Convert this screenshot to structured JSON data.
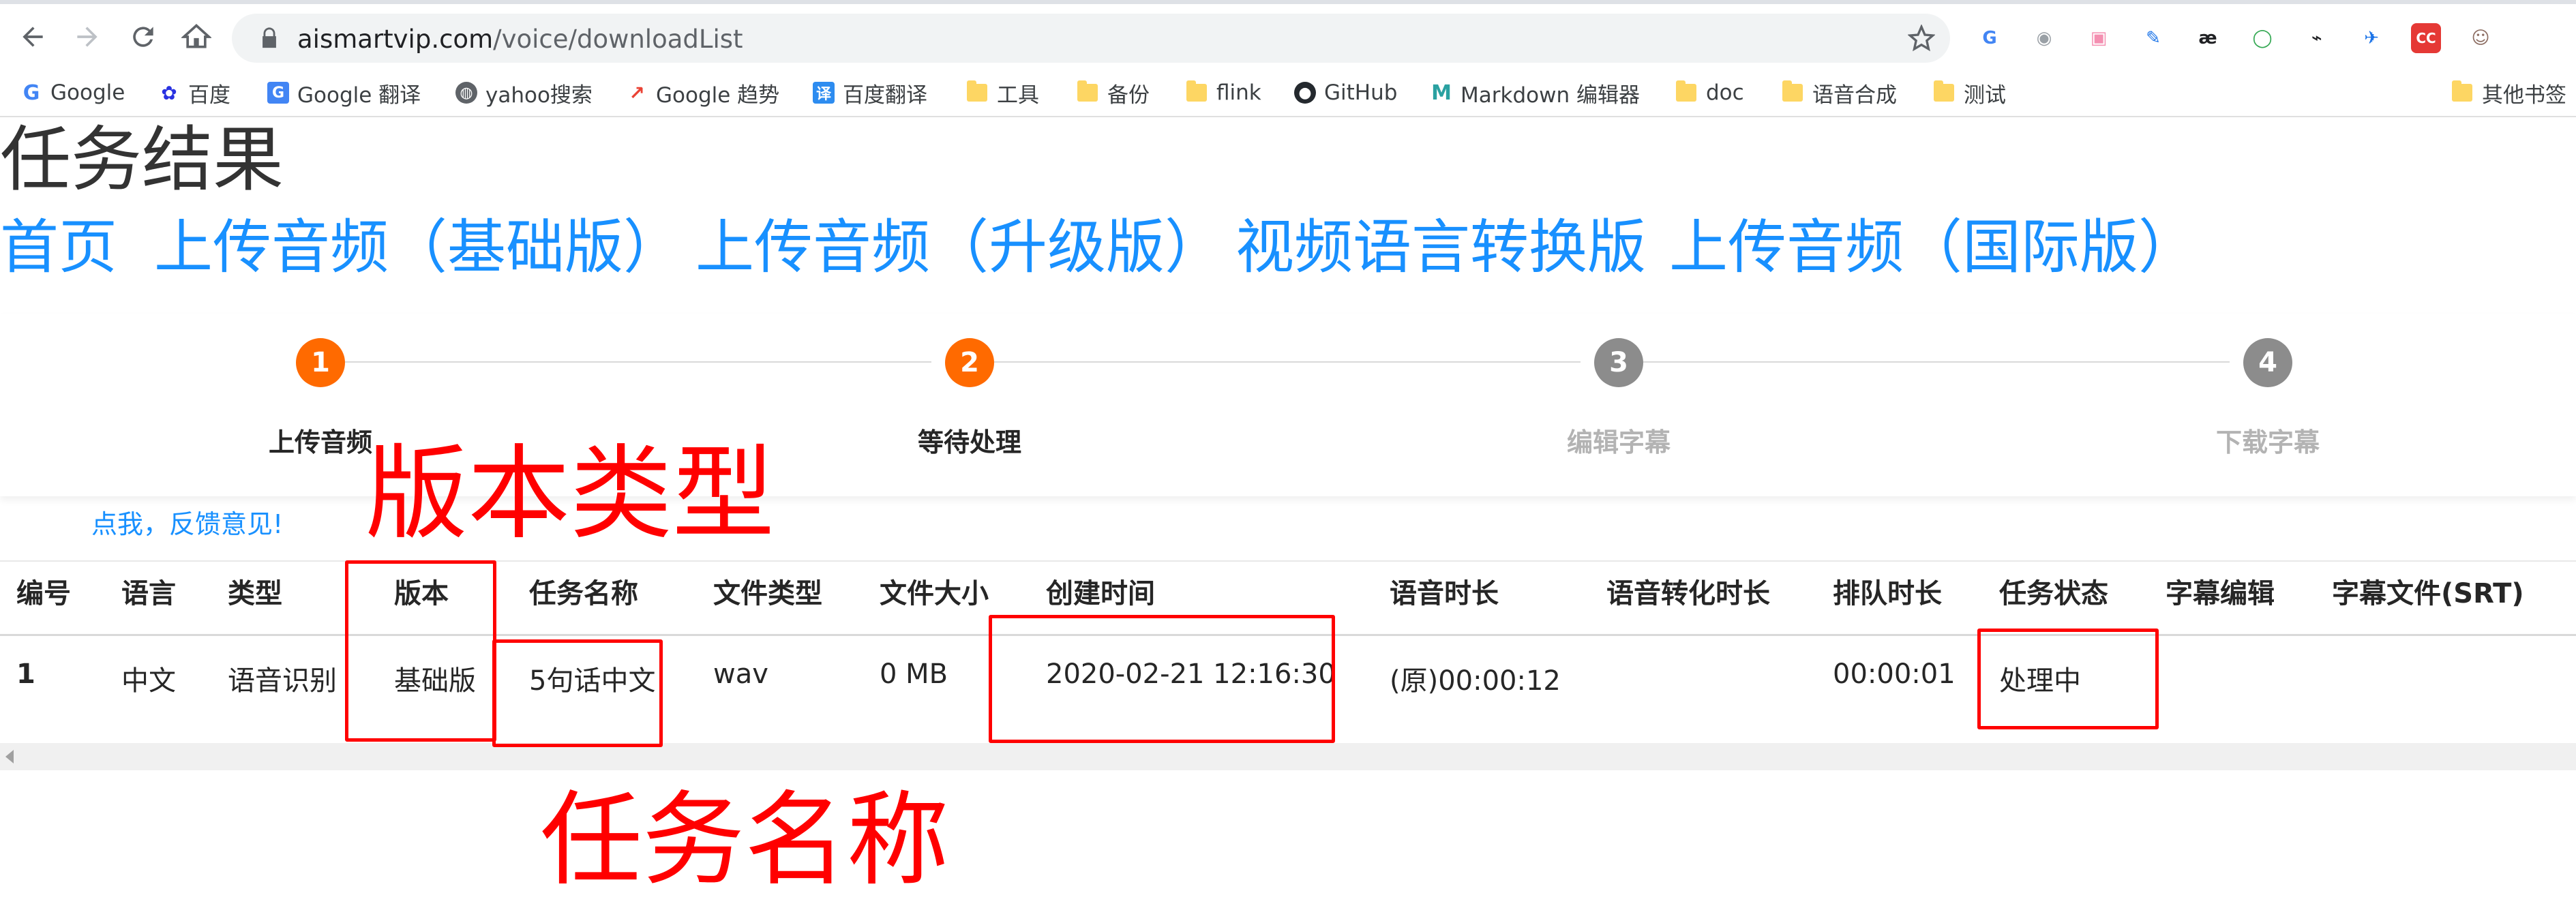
{
  "browser": {
    "url_domain": "aismartvip.com",
    "url_path": "/voice/downloadList",
    "extensions": [
      {
        "name": "translate-extension-icon",
        "glyph": "G",
        "color": "#4285f4"
      },
      {
        "name": "camera-extension-icon",
        "glyph": "◉",
        "color": "#9aa0a6"
      },
      {
        "name": "pink-extension-icon",
        "glyph": "▣",
        "color": "#f48fb1"
      },
      {
        "name": "feather-extension-icon",
        "glyph": "✎",
        "color": "#1a73e8"
      },
      {
        "name": "ae-extension-icon",
        "glyph": "æ",
        "color": "#202124"
      },
      {
        "name": "circle-extension-icon",
        "glyph": "◯",
        "color": "#34a853"
      },
      {
        "name": "en-extension-icon",
        "glyph": "⌁",
        "color": "#202124"
      },
      {
        "name": "rocket-extension-icon",
        "glyph": "✈",
        "color": "#1a73e8"
      },
      {
        "name": "cc-extension-icon",
        "glyph": "CC",
        "color": "#e53935"
      },
      {
        "name": "profile-avatar-icon",
        "glyph": "☺",
        "color": "#8d6e63"
      }
    ]
  },
  "bookmarks": [
    {
      "label": "Google",
      "icon": "google-icon"
    },
    {
      "label": "百度",
      "icon": "baidu-icon"
    },
    {
      "label": "Google 翻译",
      "icon": "google-translate-icon"
    },
    {
      "label": "yahoo搜索",
      "icon": "globe-icon"
    },
    {
      "label": "Google 趋势",
      "icon": "trends-icon"
    },
    {
      "label": "百度翻译",
      "icon": "baidu-translate-icon"
    },
    {
      "label": "工具",
      "icon": "folder-icon"
    },
    {
      "label": "备份",
      "icon": "folder-icon"
    },
    {
      "label": "flink",
      "icon": "folder-icon"
    },
    {
      "label": "GitHub",
      "icon": "github-icon"
    },
    {
      "label": "Markdown 编辑器",
      "icon": "markdown-icon"
    },
    {
      "label": "doc",
      "icon": "folder-icon"
    },
    {
      "label": "语音合成",
      "icon": "folder-icon"
    },
    {
      "label": "测试",
      "icon": "folder-icon"
    },
    {
      "label": "其他书签",
      "icon": "folder-icon"
    }
  ],
  "page": {
    "title": "任务结果",
    "nav": [
      "首页",
      "上传音频（基础版）",
      "上传音频（升级版）",
      "视频语言转换版",
      "上传音频（国际版）"
    ],
    "steps": [
      {
        "num": "1",
        "label": "上传音频",
        "state": "active"
      },
      {
        "num": "2",
        "label": "等待处理",
        "state": "active"
      },
      {
        "num": "3",
        "label": "编辑字幕",
        "state": "idle"
      },
      {
        "num": "4",
        "label": "下载字幕",
        "state": "idle"
      }
    ],
    "feedback": "点我，反馈意见!"
  },
  "table": {
    "headers": [
      "编号",
      "语言",
      "类型",
      "版本",
      "任务名称",
      "文件类型",
      "文件大小",
      "创建时间",
      "语音时长",
      "语音转化时长",
      "排队时长",
      "任务状态",
      "字幕编辑",
      "字幕文件(SRT)"
    ],
    "rows": [
      [
        "1",
        "中文",
        "语音识别",
        "基础版",
        "5句话中文",
        "wav",
        "0 MB",
        "2020-02-21 12:16:30",
        "(原)00:00:12",
        "",
        "00:00:01",
        "处理中",
        "",
        ""
      ]
    ]
  },
  "annotations": {
    "version_type_label": "版本类型",
    "task_name_label": "任务名称",
    "color": "#ff0000"
  }
}
